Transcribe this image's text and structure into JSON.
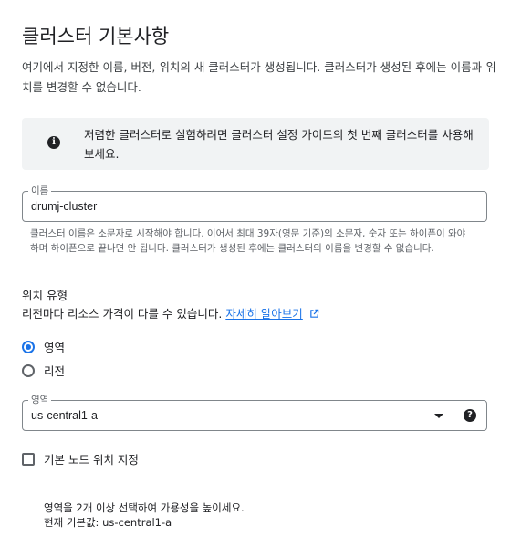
{
  "header": {
    "title": "클러스터 기본사항",
    "description": "여기에서 지정한 이름, 버전, 위치의 새 클러스터가 생성됩니다. 클러스터가 생성된 후에는 이름과 위치를 변경할 수 없습니다."
  },
  "info": {
    "icon": "info-icon",
    "text": "저렴한 클러스터로 실험하려면 클러스터 설정 가이드의 첫 번째 클러스터를 사용해 보세요."
  },
  "name_field": {
    "label": "이름",
    "value": "drumj-cluster",
    "hint": "클러스터 이름은 소문자로 시작해야 합니다. 이어서 최대 39자(영문 기준)의 소문자, 숫자 또는 하이픈이 와야 하며 하이픈으로 끝나면 안 됩니다. 클러스터가 생성된 후에는 클러스터의 이름을 변경할 수 없습니다."
  },
  "location": {
    "heading": "위치 유형",
    "description": "리전마다 리소스 가격이 다를 수 있습니다.",
    "link_text": "자세히 알아보기",
    "options": [
      {
        "label": "영역",
        "checked": true
      },
      {
        "label": "리전",
        "checked": false
      }
    ]
  },
  "zone_select": {
    "label": "영역",
    "value": "us-central1-a"
  },
  "default_nodes": {
    "label": "기본 노드 위치 지정",
    "checked": false
  },
  "zone_note": {
    "line1": "영역을 2개 이상 선택하여 가용성을 높이세요.",
    "line2": "현재 기본값: us-central1-a"
  },
  "colors": {
    "accent": "#1a73e8",
    "info_bg": "#f1f3f4",
    "text": "#202124",
    "muted": "#5f6368"
  }
}
